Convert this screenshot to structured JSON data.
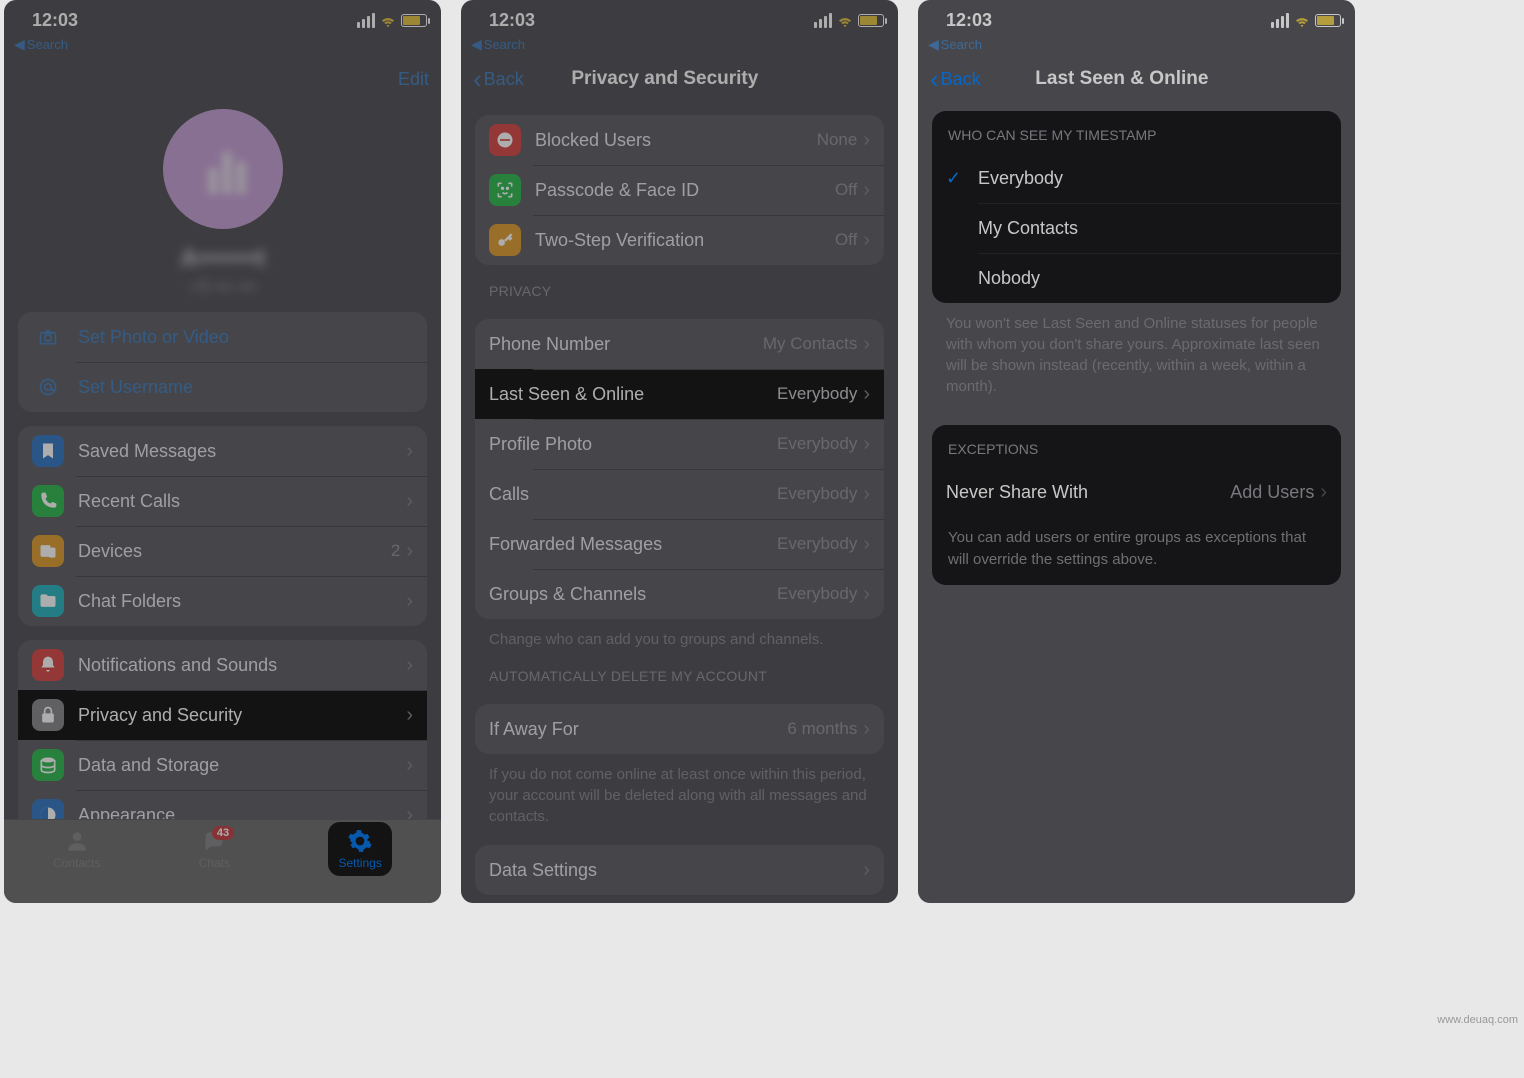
{
  "statusbar": {
    "time": "12:03",
    "back": "Search"
  },
  "s1": {
    "edit": "Edit",
    "username": "A•••••••t",
    "phone": "+9 ••• •••",
    "setPhoto": "Set Photo or Video",
    "setUsername": "Set Username",
    "list1": [
      {
        "icon": "bookmark",
        "color": "#3f7fc7",
        "label": "Saved Messages",
        "val": ""
      },
      {
        "icon": "phone",
        "color": "#3bbd5b",
        "label": "Recent Calls",
        "val": ""
      },
      {
        "icon": "devices",
        "color": "#e0a33d",
        "label": "Devices",
        "val": "2"
      },
      {
        "icon": "folder",
        "color": "#35b8c4",
        "label": "Chat Folders",
        "val": ""
      }
    ],
    "list2": [
      {
        "icon": "bell",
        "color": "#d95252",
        "label": "Notifications and Sounds",
        "val": ""
      },
      {
        "icon": "lock",
        "color": "#8e8e93",
        "label": "Privacy and Security",
        "val": "",
        "highlight": true
      },
      {
        "icon": "db",
        "color": "#3bbd5b",
        "label": "Data and Storage",
        "val": ""
      },
      {
        "icon": "appearance",
        "color": "#3f7fc7",
        "label": "Appearance",
        "val": ""
      }
    ],
    "tabs": {
      "contacts": "Contacts",
      "chats": "Chats",
      "chatsBadge": "43",
      "settings": "Settings"
    }
  },
  "s2": {
    "back": "Back",
    "title": "Privacy and Security",
    "g1": [
      {
        "icon": "block",
        "color": "#d95252",
        "label": "Blocked Users",
        "val": "None"
      },
      {
        "icon": "faceid",
        "color": "#3bbd5b",
        "label": "Passcode & Face ID",
        "val": "Off"
      },
      {
        "icon": "key",
        "color": "#e0a33d",
        "label": "Two-Step Verification",
        "val": "Off"
      }
    ],
    "h2": "PRIVACY",
    "g2": [
      {
        "label": "Phone Number",
        "val": "My Contacts"
      },
      {
        "label": "Last Seen & Online",
        "val": "Everybody",
        "highlight": true
      },
      {
        "label": "Profile Photo",
        "val": "Everybody"
      },
      {
        "label": "Calls",
        "val": "Everybody"
      },
      {
        "label": "Forwarded Messages",
        "val": "Everybody"
      },
      {
        "label": "Groups & Channels",
        "val": "Everybody"
      }
    ],
    "f2": "Change who can add you to groups and channels.",
    "h3": "AUTOMATICALLY DELETE MY ACCOUNT",
    "g3": [
      {
        "label": "If Away For",
        "val": "6 months"
      }
    ],
    "f3": "If you do not come online at least once within this period, your account will be deleted along with all messages and contacts.",
    "g4": [
      {
        "label": "Data Settings",
        "val": ""
      }
    ]
  },
  "s3": {
    "back": "Back",
    "title": "Last Seen & Online",
    "h1": "WHO CAN SEE MY TIMESTAMP",
    "opts": [
      {
        "label": "Everybody",
        "checked": true
      },
      {
        "label": "My Contacts",
        "checked": false
      },
      {
        "label": "Nobody",
        "checked": false
      }
    ],
    "f1": "You won't see Last Seen and Online statuses for people with whom you don't share yours. Approximate last seen will be shown instead (recently, within a week, within a month).",
    "h2": "EXCEPTIONS",
    "never": {
      "label": "Never Share With",
      "val": "Add Users"
    },
    "f2": "You can add users or entire groups as exceptions that will override the settings above."
  },
  "watermark": "www.deuaq.com"
}
